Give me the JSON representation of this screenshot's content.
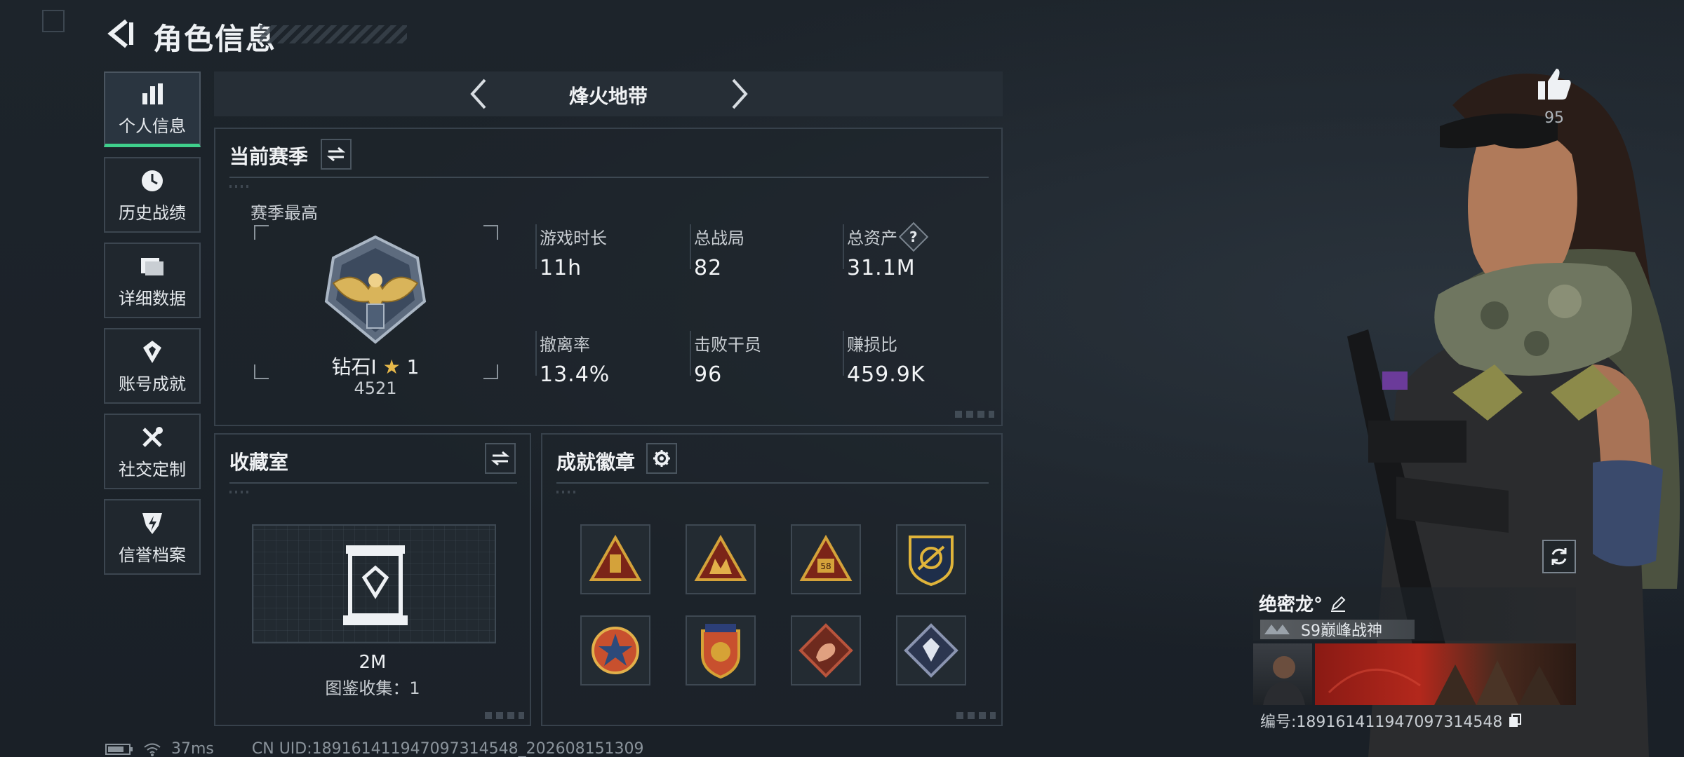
{
  "header": {
    "title": "角色信息"
  },
  "side_nav": [
    {
      "label": "个人信息",
      "icon": "bar-chart-icon",
      "active": true
    },
    {
      "label": "历史战绩",
      "icon": "history-icon",
      "active": false
    },
    {
      "label": "详细数据",
      "icon": "folder-icon",
      "active": false
    },
    {
      "label": "账号成就",
      "icon": "achievement-icon",
      "active": false
    },
    {
      "label": "社交定制",
      "icon": "tools-icon",
      "active": false
    },
    {
      "label": "信誉档案",
      "icon": "reputation-icon",
      "active": false
    }
  ],
  "mode": {
    "title": "烽火地带"
  },
  "season": {
    "title": "当前赛季",
    "best_label": "赛季最高",
    "rank_name": "钻石Ⅰ",
    "rank_stars": "1",
    "rank_score": "4521",
    "stats": [
      {
        "label": "游戏时长",
        "value": "11h"
      },
      {
        "label": "总战局",
        "value": "82"
      },
      {
        "label": "总资产",
        "value": "31.1M"
      },
      {
        "label": "撤离率",
        "value": "13.4%"
      },
      {
        "label": "击败干员",
        "value": "96"
      },
      {
        "label": "赚损比",
        "value": "459.9K"
      }
    ],
    "help_mark": "?"
  },
  "collection": {
    "title": "收藏室",
    "value": "2M",
    "count_text": "图鉴收集：1"
  },
  "achievements": {
    "title": "成就徽章",
    "badges": [
      {
        "icon": "triangle-badge-icon",
        "color": "#d4a23a"
      },
      {
        "icon": "triangle-team-badge-icon",
        "color": "#d4a23a"
      },
      {
        "icon": "triangle-58-badge-icon",
        "color": "#d4a23a",
        "text": "58"
      },
      {
        "icon": "shield-badge-icon",
        "color": "#e0b43a"
      },
      {
        "icon": "star-emblem-badge-icon",
        "color": "#c8502e"
      },
      {
        "icon": "crest-badge-icon",
        "color": "#d6a236"
      },
      {
        "icon": "dragon-badge-icon",
        "color": "#b8543c"
      },
      {
        "icon": "diamond-badge-icon",
        "color": "#8a94b0"
      }
    ]
  },
  "likes": {
    "count": "95"
  },
  "player": {
    "name": "绝密龙°",
    "title_badge": "S9巅峰战神",
    "id_label": "编号:1891614119470973145​48"
  },
  "footer": {
    "ping": "37ms",
    "uid": "CN UID:1891614119470973145​48_202608151309"
  },
  "colors": {
    "accent_green": "#3fd08c",
    "panel_border": "#37414b",
    "bg": "#1b2128"
  }
}
